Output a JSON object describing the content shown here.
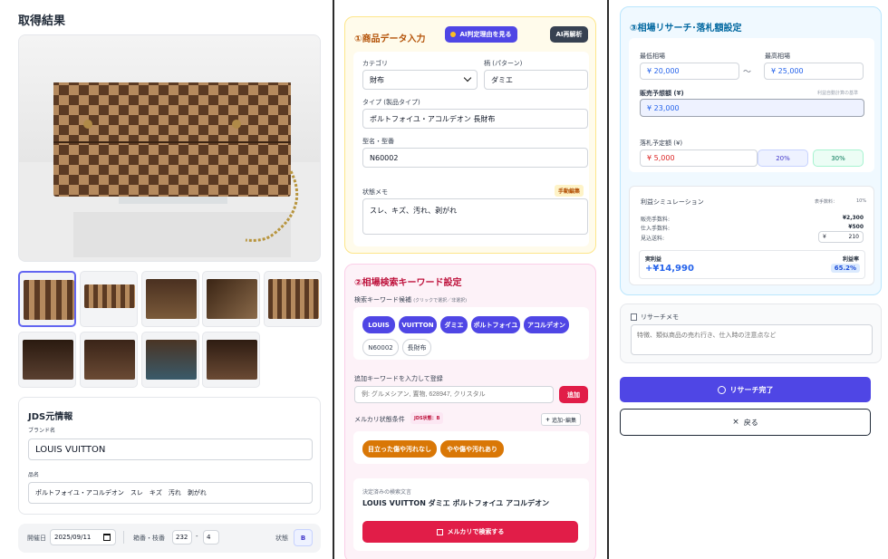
{
  "left": {
    "title": "取得結果",
    "jds": {
      "title": "JDS元情報",
      "brand_label": "ブランド名",
      "brand_value": "LOUIS VUITTON",
      "item_label": "品名",
      "item_value": "ポルトフォイユ・アコルデオン　スレ　キズ　汚れ　剥がれ"
    },
    "footer": {
      "date_label": "開催日",
      "date_value": "2025/09/11",
      "box_label": "箱番・枝番",
      "box_no": "232",
      "box_dash": "-",
      "branch_no": "4",
      "state_label": "状態",
      "state_value": "B"
    }
  },
  "mid": {
    "sec1": {
      "title": "①商品データ入力",
      "reason_btn": "AI判定理由を見る",
      "reanalyze_btn": "AI再解析",
      "category_label": "カテゴリ",
      "category_value": "財布",
      "pattern_label": "柄 (パターン)",
      "pattern_value": "ダミエ",
      "type_label": "タイプ (製品タイプ)",
      "type_value": "ポルトフォイユ・アコルデオン 長財布",
      "model_label": "型名・型番",
      "model_value": "N60002",
      "memo_label": "状態メモ",
      "memo_badge": "手動編集",
      "memo_value": "スレ、キズ、汚れ、剥がれ"
    },
    "sec2": {
      "title": "②相場検索キーワード設定",
      "kw_label": "検索キーワード候補",
      "kw_hint": "(クリックで選択／非選択)",
      "keywords": [
        "LOUIS",
        "VUITTON",
        "ダミエ",
        "ポルトフォイユ",
        "アコルデオン",
        "N60002",
        "長財布"
      ],
      "add_label": "追加キーワードを入力して登録",
      "add_placeholder": "例: グルメシアン, 置物, 628947, クリスタル",
      "add_btn": "追加",
      "cond_label": "メルカリ状態条件",
      "cond_badge": "JDS状態：B",
      "cond_edit": "追加･編集",
      "conditions": [
        "目立った傷や汚れなし",
        "やや傷や汚れあり"
      ],
      "final_label": "決定済みの検索文言",
      "final_value": "LOUIS VUITTON ダミエ ポルトフォイユ アコルデオン",
      "search_btn": "メルカリで検索する"
    }
  },
  "right": {
    "title": "③相場リサーチ･落札額設定",
    "low_label": "最低相場",
    "low_value": "¥ 20,000",
    "tilde": "〜",
    "high_label": "最高相場",
    "high_value": "¥ 25,000",
    "sale_label": "販売予想額 (¥)",
    "sale_hint": "利益自動計算の基準",
    "sale_value": "¥ 23,000",
    "bid_label": "落札予定額 (¥)",
    "bid_value": "¥ 5,000",
    "pct1": "20%",
    "pct2": "30%",
    "sim": {
      "title": "利益シミュレーション",
      "fee_label": "表手数料：",
      "fee_rate": "10%",
      "rows": [
        {
          "label": "販売手数料:",
          "value": "¥2,300"
        },
        {
          "label": "仕入手数料:",
          "value": "¥500"
        }
      ],
      "ship_label": "見込送料:",
      "ship_yen": "¥",
      "ship_value": "210",
      "profit_label": "実利益",
      "profit_value": "+¥14,990",
      "rate_label": "利益率",
      "rate_value": "65.2%"
    },
    "memo_label": "リサーチメモ",
    "memo_placeholder": "特徴、類似商品の売れ行き、仕入時の注意点など",
    "done_btn": "リサーチ完了",
    "back_btn": "戻る"
  }
}
